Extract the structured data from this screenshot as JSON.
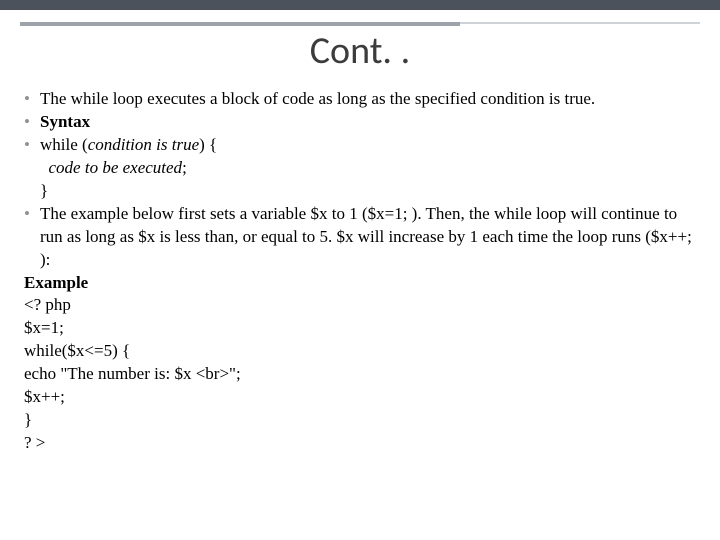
{
  "title": "Cont. .",
  "bullets": {
    "b1": "The while loop executes a block of code as long as the specified condition is true.",
    "b2": "Syntax",
    "b3_pre": "while (",
    "b3_cond": "condition is true",
    "b3_post": ") {",
    "b3_line2": "code to be executed",
    "b3_line2_post": ";",
    "b3_line3": "}",
    "b4": "The example below first sets a variable $x to 1 ($x=1; ). Then, the while loop will continue to run as long as $x is less than, or equal to 5. $x will increase by 1 each time the loop runs ($x++; ):"
  },
  "example_label": "Example",
  "code": {
    "l1": "<? php",
    "l2": "$x=1;",
    "l3": "while($x<=5) {",
    "l4": "  echo \"The number is: $x <br>\";",
    "l5": "  $x++;",
    "l6": "}",
    "l7": "? >"
  }
}
